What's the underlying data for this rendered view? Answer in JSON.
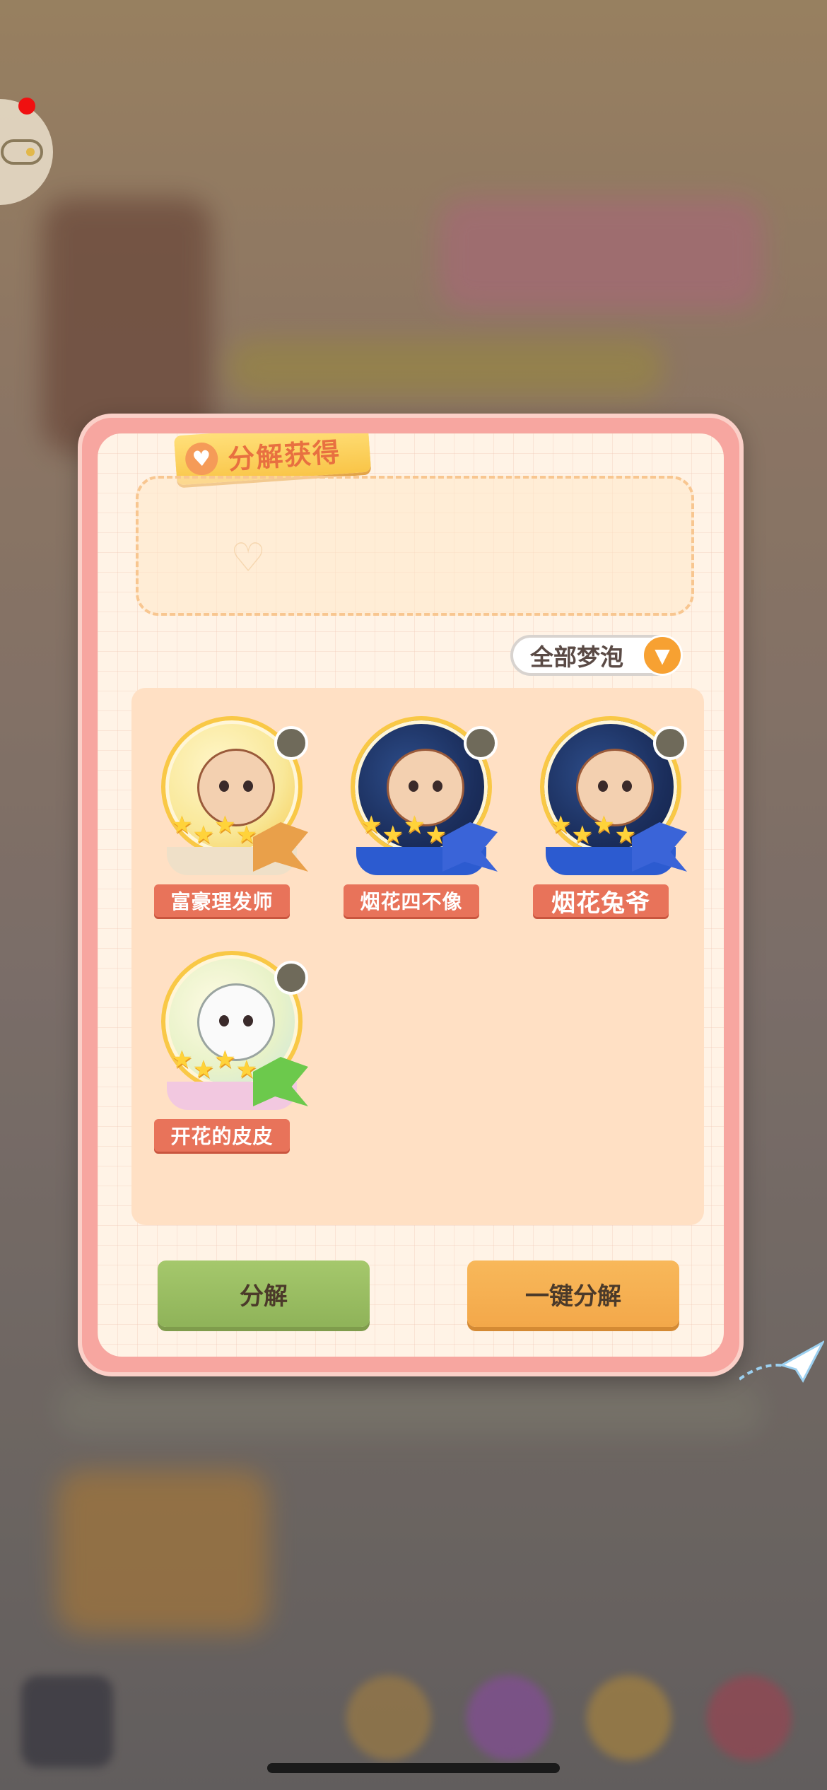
{
  "panel": {
    "title": "分解获得",
    "filter_label": "全部梦泡"
  },
  "items": [
    {
      "name": "富豪理发师",
      "stars": 4
    },
    {
      "name": "烟花四不像",
      "stars": 4
    },
    {
      "name": "烟花兔爷",
      "stars": 4
    },
    {
      "name": "开花的皮皮",
      "stars": 4
    }
  ],
  "buttons": {
    "decompose": "分解",
    "decompose_all": "一键分解"
  },
  "icons": {
    "game": "gamepad-icon",
    "filter": "chevron-down-icon",
    "title": "heart-icon",
    "plane": "paper-plane-icon"
  },
  "colors": {
    "accent_orange": "#f7a132",
    "panel_pink": "#f7a6a0",
    "name_tag": "#e8735a",
    "button_green": "#9bbd62",
    "button_orange": "#f5ae52"
  }
}
